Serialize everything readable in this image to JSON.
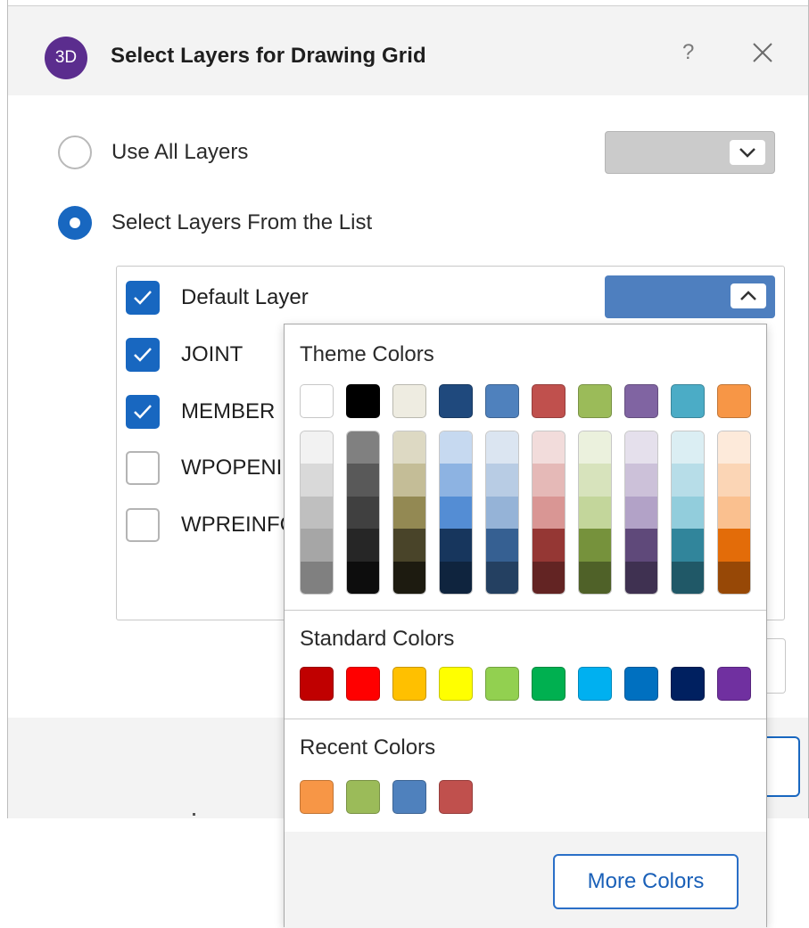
{
  "dialog": {
    "app_icon_text": "3D",
    "title": "Select Layers for Drawing Grid",
    "help_label": "?",
    "close_icon": "close-icon"
  },
  "options": {
    "use_all": {
      "label": "Use All Layers",
      "selected": false
    },
    "select_from_list": {
      "label": "Select Layers From the List",
      "selected": true
    }
  },
  "layers": [
    {
      "label": "Default Layer",
      "checked": true
    },
    {
      "label": "JOINT",
      "checked": true
    },
    {
      "label": "MEMBER",
      "checked": true
    },
    {
      "label": "WPOPENI",
      "checked": false
    },
    {
      "label": "WPREINFC",
      "checked": false
    }
  ],
  "layer_color": {
    "selected": "#4e7fbf"
  },
  "colors": {
    "accent": "#1867c0",
    "titlebar": "#f3f3f3",
    "top_combo": "#cbcbcb"
  },
  "picker": {
    "theme_title": "Theme Colors",
    "standard_title": "Standard Colors",
    "recent_title": "Recent Colors",
    "more_button": "More Colors",
    "theme_base": [
      "#ffffff",
      "#000000",
      "#eeece1",
      "#1f497d",
      "#4f81bd",
      "#c0504d",
      "#9bbb59",
      "#8064a2",
      "#4bacc6",
      "#f79646"
    ],
    "theme_shades": [
      [
        "#f2f2f2",
        "#d9d9d9",
        "#bfbfbf",
        "#a6a6a6",
        "#808080"
      ],
      [
        "#808080",
        "#595959",
        "#404040",
        "#262626",
        "#0d0d0d"
      ],
      [
        "#ddd9c3",
        "#c4bd97",
        "#938953",
        "#494429",
        "#1d1b10"
      ],
      [
        "#c6d9f0",
        "#8db3e2",
        "#548dd4",
        "#17365d",
        "#0f243e"
      ],
      [
        "#dbe5f1",
        "#b8cce4",
        "#95b3d7",
        "#366092",
        "#244061"
      ],
      [
        "#f2dcdb",
        "#e5b9b7",
        "#d99694",
        "#953734",
        "#632423"
      ],
      [
        "#ebf1dd",
        "#d7e3bc",
        "#c3d69b",
        "#76923c",
        "#4f6128"
      ],
      [
        "#e5e0ec",
        "#ccc1d9",
        "#b2a2c7",
        "#5f497a",
        "#3f3151"
      ],
      [
        "#dbeef3",
        "#b7dde8",
        "#92cddc",
        "#31859b",
        "#205867"
      ],
      [
        "#fdeada",
        "#fbd5b5",
        "#fac08f",
        "#e36c09",
        "#974806"
      ]
    ],
    "standard": [
      "#c00000",
      "#ff0000",
      "#ffc000",
      "#ffff00",
      "#92d050",
      "#00b050",
      "#00b0f0",
      "#0070c0",
      "#002060",
      "#7030a0"
    ],
    "recent": [
      "#f79646",
      "#9bbb59",
      "#4f81bd",
      "#c0504d"
    ]
  }
}
